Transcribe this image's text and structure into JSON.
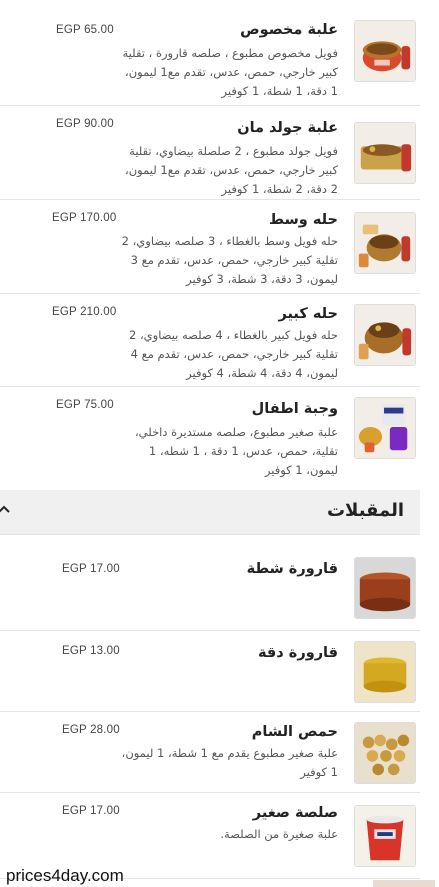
{
  "items": [
    {
      "name": "علبة مخصوص",
      "price": "EGP 65.00",
      "description": "فويل مخصوص مطبوع ، صلصه قارورة ، تقلية كبير خارجي، حمص، عدس، تقدم مع1 ليمون، 1 دقة، 1 شطة، 1 كوفير",
      "image": "bowl-image"
    },
    {
      "name": "علبة جولد مان",
      "price": "EGP 90.00",
      "description": "فويل جولد مطبوع ، 2 صلصلة بيضاوي، تقلية كبير خارجي، حمص، عدس، تقدم مع1 ليمون، 2 دقة، 2 شطة، 1 كوفير",
      "image": "tray-image"
    },
    {
      "name": "حله وسط",
      "price": "EGP 170.00",
      "description": "حله فويل وسط بالغطاء ، 3 صلصه بيضاوي، 2 تقلية كبير خارجي، حمص، عدس، تقدم مع 3 ليمون، 3 دقة، 3 شطة، 3 كوفير",
      "image": "pot-image"
    },
    {
      "name": "حله كبير",
      "price": "EGP 210.00",
      "description": "حله فويل كبير بالغطاء ، 4 صلصه بيضاوي، 2 تقلية كبير خارجي، حمص، عدس، تقدم مع 4 ليمون، 4 دقة، 4 شطة، 4 كوفير",
      "image": "pot-image"
    },
    {
      "name": "وجبة اطفال",
      "price": "EGP 75.00",
      "description": "علبة صغير مطبوع، صلصه مستديرة داخلي، تقلية، حمص، عدس، 1 دقة ، 1 شطه، 1 ليمون، 1 كوفير",
      "image": "kids-image"
    }
  ],
  "section": {
    "title": "المقبلات"
  },
  "appetizers": [
    {
      "name": "قارورة شطة",
      "price": "EGP 17.00",
      "description": "",
      "image": "sauce-jar-image"
    },
    {
      "name": "قارورة دقة",
      "price": "EGP 13.00",
      "description": "",
      "image": "dressing-image"
    },
    {
      "name": "حمص الشام",
      "price": "EGP 28.00",
      "description": "علبة صغير مطبوع يقدم مع 1 شطة، 1 ليمون، 1 كوفير",
      "image": "chickpea-image"
    },
    {
      "name": "صلصة صغير",
      "price": "EGP 17.00",
      "description": "علبة صغيرة من الصلصة.",
      "image": "red-cup-image"
    }
  ],
  "watermark": "prices4day.com"
}
